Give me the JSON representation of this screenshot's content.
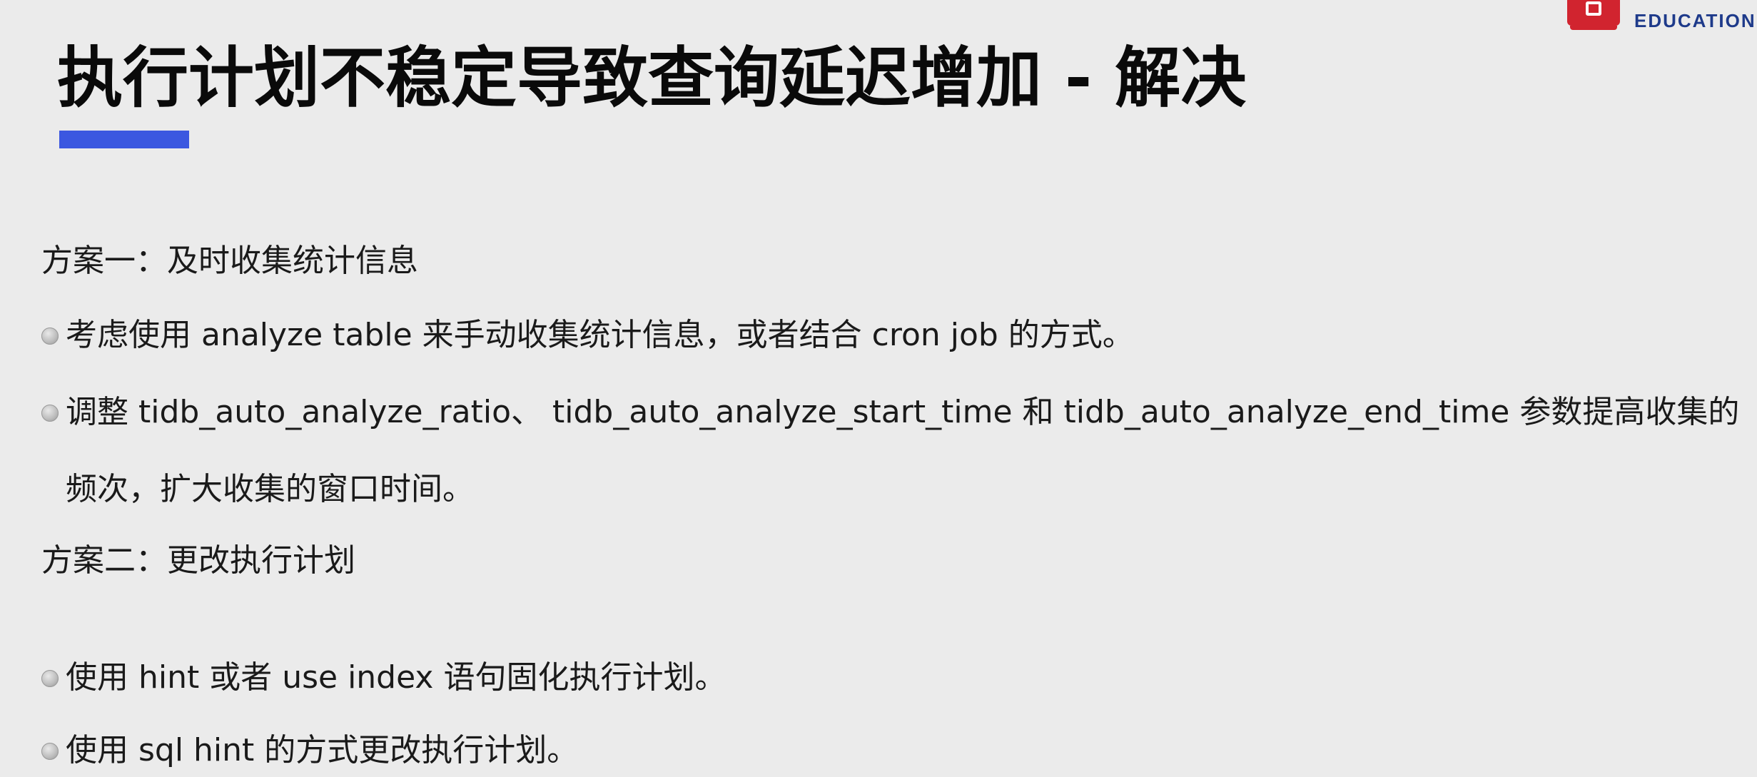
{
  "brand": {
    "name": "EDUCATION",
    "color": "#d1242f",
    "text_color": "#1e3a8a"
  },
  "title": "执行计划不稳定导致查询延迟增加 - 解决",
  "accent_color": "#3b57e0",
  "sections": [
    {
      "heading": "方案一：及时收集统计信息",
      "bullets": [
        "考虑使用 analyze table 来手动收集统计信息，或者结合 cron job 的方式。",
        "调整 tidb_auto_analyze_ratio、 tidb_auto_analyze_start_time 和 tidb_auto_analyze_end_time 参数提高收集的频次，扩大收集的窗口时间。"
      ]
    },
    {
      "heading": "方案二：更改执行计划",
      "bullets": [
        "使用 hint 或者 use index 语句固化执行计划。",
        "使用 sql hint 的方式更改执行计划。"
      ]
    }
  ]
}
